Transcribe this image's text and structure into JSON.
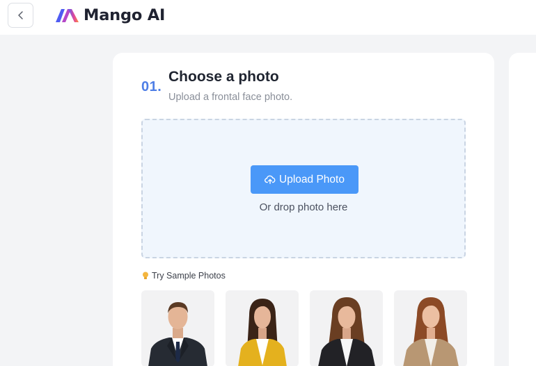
{
  "header": {
    "back_label": "Back",
    "brand_name": "Mango AI"
  },
  "step": {
    "number": "01.",
    "title": "Choose a photo",
    "subtitle": "Upload a frontal face photo."
  },
  "dropzone": {
    "upload_button": "Upload Photo",
    "drop_hint": "Or drop photo here"
  },
  "samples": {
    "label": "Try Sample Photos",
    "items": [
      {
        "desc": "man in black suit and tie",
        "accent": "#262b33"
      },
      {
        "desc": "woman in yellow blazer",
        "accent": "#e4b11e"
      },
      {
        "desc": "woman in black blazer",
        "accent": "#222226"
      },
      {
        "desc": "woman in beige blazer",
        "accent": "#b89773"
      }
    ]
  },
  "colors": {
    "accent_blue": "#4a98f8",
    "step_blue": "#4e7ee6",
    "brand_gradient": [
      "#5b5ef6",
      "#e0479b",
      "#ff8a3d"
    ]
  }
}
